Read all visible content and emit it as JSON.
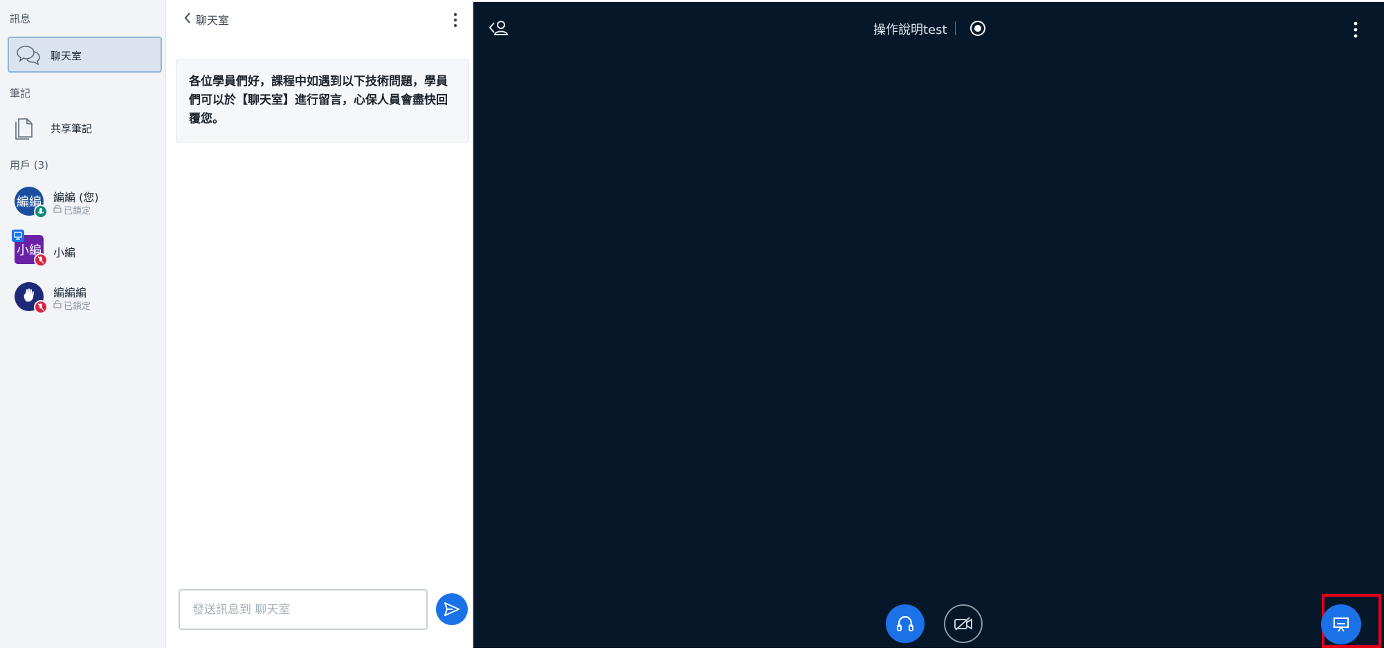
{
  "sidebar": {
    "messages_heading": "訊息",
    "chat_item": {
      "label": "聊天室",
      "icon": "chat-bubbles-icon"
    },
    "notes_heading": "筆記",
    "notes_item": {
      "label": "共享筆記",
      "icon": "document-icon"
    },
    "users_heading": "用戶 (3)",
    "users": [
      {
        "avatar_text": "編編",
        "name": "編編 (您)",
        "status": "已鎖定",
        "avatar_color": "#1a4fa0",
        "badge_color": "#0b8a7a"
      },
      {
        "avatar_text": "小編",
        "name": "小編",
        "status": "",
        "avatar_color": "#6a21a8",
        "badge_color": "#d7263d"
      },
      {
        "avatar_text": "",
        "name": "編編編",
        "status": "已鎖定",
        "avatar_color": "#1e2a78",
        "badge_color": "#d7263d"
      }
    ]
  },
  "chat": {
    "back_label": "聊天室",
    "welcome_message": "各位學員們好，課程中如遇到以下技術問題，學員們可以於【聊天室】進行留言，心保人員會盡快回覆您。",
    "input_placeholder": "發送訊息到 聊天室"
  },
  "main": {
    "title": "操作說明test",
    "accent_color": "#1b72e8",
    "background_color": "#06172a",
    "highlight_color": "#e3001b"
  }
}
